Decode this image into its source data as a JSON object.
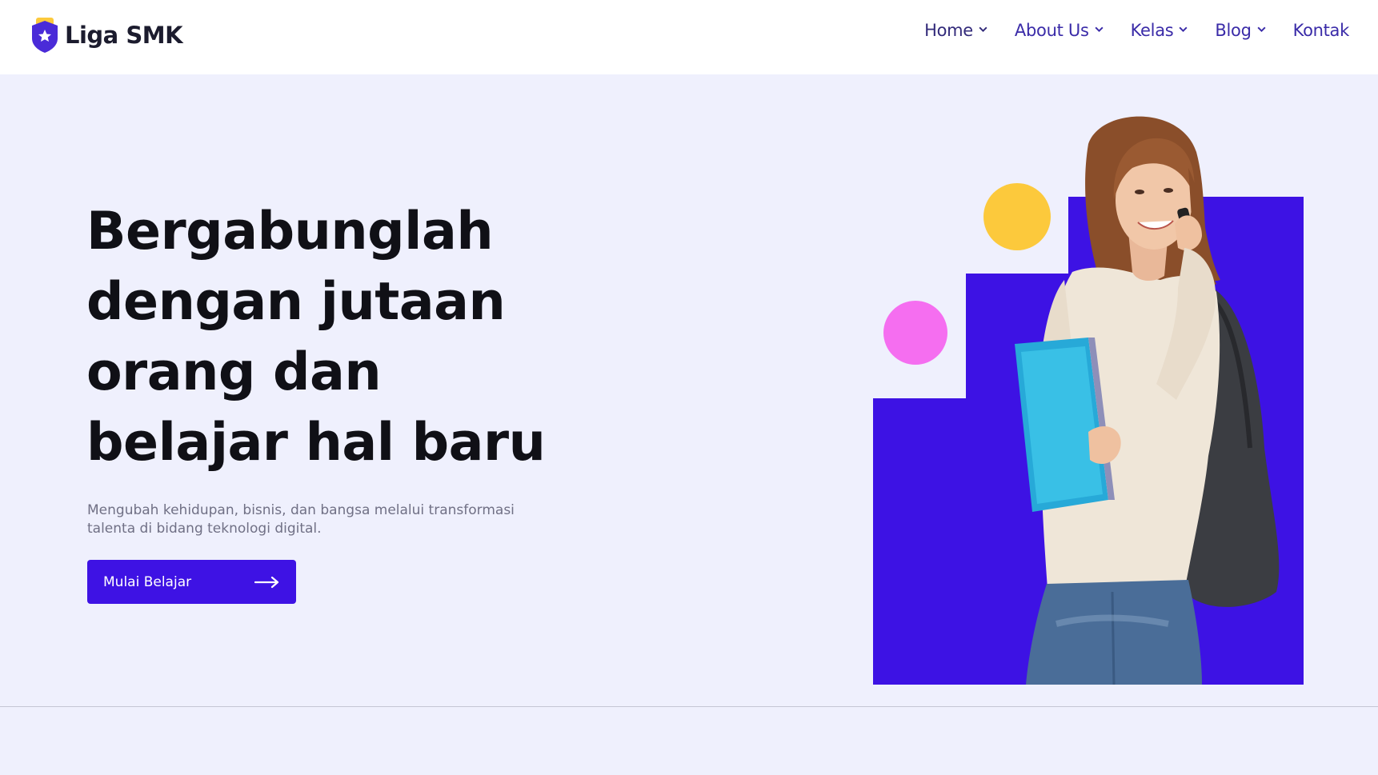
{
  "header": {
    "brand": "Liga SMK",
    "logo_icon": "shield-star-icon",
    "nav": [
      {
        "label": "Home",
        "has_dropdown": true
      },
      {
        "label": "About Us",
        "has_dropdown": true
      },
      {
        "label": "Kelas",
        "has_dropdown": true
      },
      {
        "label": "Blog",
        "has_dropdown": true
      },
      {
        "label": "Kontak",
        "has_dropdown": false
      }
    ]
  },
  "hero": {
    "title_lines": [
      "Bergabunglah",
      "dengan jutaan",
      "orang dan",
      "belajar hal baru"
    ],
    "subtitle": "Mengubah kehidupan, bisnis, dan bangsa melalui transformasi talenta di bidang teknologi digital.",
    "cta_label": "Mulai Belajar",
    "cta_icon": "arrow-right-icon"
  },
  "colors": {
    "accent": "#3e12e4",
    "yellow_dot": "#fcc93c",
    "pink_dot": "#f56ef0",
    "background": "#eff0fd",
    "nav_text": "#3a2ba8"
  }
}
